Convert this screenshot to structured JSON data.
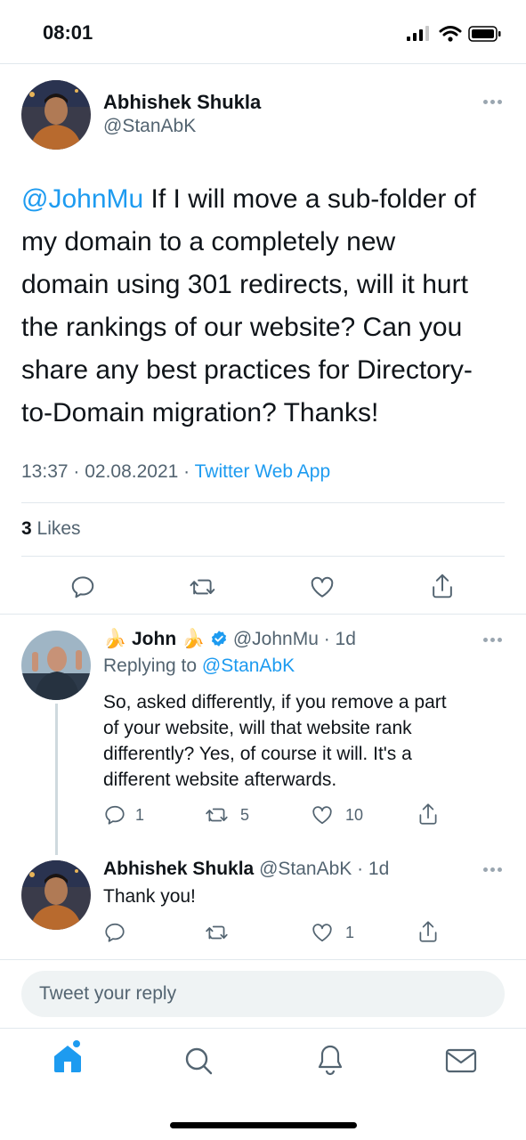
{
  "status_bar": {
    "time": "08:01"
  },
  "main_tweet": {
    "author_name": "Abhishek Shukla",
    "author_handle": "@StanAbK",
    "mention": "@JohnMu",
    "text_line1": "If I will move a sub-folder of",
    "text_line2": "my domain to a completely new",
    "text_line3": "domain using 301 redirects, will it hurt",
    "text_line4": "the rankings of our website? Can you",
    "text_line5": "share any best practices for Directory-",
    "text_line6": "to-Domain migration? Thanks!",
    "timestamp": "13:37 · 02.08.2021 ·",
    "source": "Twitter Web App",
    "likes_count": "3",
    "likes_label": "Likes"
  },
  "reply1": {
    "name_prefix_emoji": "🍌",
    "author_name": "John",
    "name_suffix_emoji": "🍌",
    "handle_time": "@JohnMu · 1d",
    "replying_to_label": "Replying to",
    "replying_to_handle": "@StanAbK",
    "text_line1": "So, asked differently, if you remove a part",
    "text_line2": "of your website, will that website rank",
    "text_line3": "differently? Yes, of course it will. It's a",
    "text_line4": "different website afterwards.",
    "reply_count": "1",
    "retweet_count": "5",
    "like_count": "10"
  },
  "reply2": {
    "author_name": "Abhishek Shukla",
    "handle_time": "@StanAbK · 1d",
    "text": "Thank you!",
    "like_count": "1"
  },
  "composer": {
    "placeholder": "Tweet your reply"
  },
  "colors": {
    "accent": "#1d9bf0",
    "text": "#0f1419",
    "secondary": "#536471"
  },
  "icons": [
    "reply-icon",
    "retweet-icon",
    "like-icon",
    "share-icon",
    "home-icon",
    "search-icon",
    "notifications-icon",
    "messages-icon",
    "verified-icon"
  ]
}
